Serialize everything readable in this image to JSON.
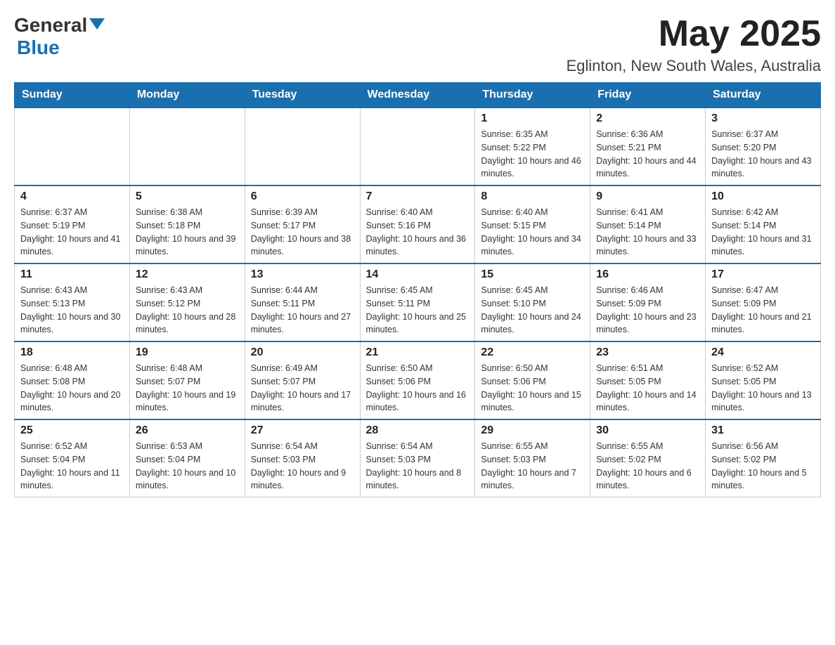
{
  "header": {
    "logo_general": "General",
    "logo_blue": "Blue",
    "month_year": "May 2025",
    "location": "Eglinton, New South Wales, Australia"
  },
  "weekdays": [
    "Sunday",
    "Monday",
    "Tuesday",
    "Wednesday",
    "Thursday",
    "Friday",
    "Saturday"
  ],
  "weeks": [
    [
      {
        "day": "",
        "info": ""
      },
      {
        "day": "",
        "info": ""
      },
      {
        "day": "",
        "info": ""
      },
      {
        "day": "",
        "info": ""
      },
      {
        "day": "1",
        "info": "Sunrise: 6:35 AM\nSunset: 5:22 PM\nDaylight: 10 hours and 46 minutes."
      },
      {
        "day": "2",
        "info": "Sunrise: 6:36 AM\nSunset: 5:21 PM\nDaylight: 10 hours and 44 minutes."
      },
      {
        "day": "3",
        "info": "Sunrise: 6:37 AM\nSunset: 5:20 PM\nDaylight: 10 hours and 43 minutes."
      }
    ],
    [
      {
        "day": "4",
        "info": "Sunrise: 6:37 AM\nSunset: 5:19 PM\nDaylight: 10 hours and 41 minutes."
      },
      {
        "day": "5",
        "info": "Sunrise: 6:38 AM\nSunset: 5:18 PM\nDaylight: 10 hours and 39 minutes."
      },
      {
        "day": "6",
        "info": "Sunrise: 6:39 AM\nSunset: 5:17 PM\nDaylight: 10 hours and 38 minutes."
      },
      {
        "day": "7",
        "info": "Sunrise: 6:40 AM\nSunset: 5:16 PM\nDaylight: 10 hours and 36 minutes."
      },
      {
        "day": "8",
        "info": "Sunrise: 6:40 AM\nSunset: 5:15 PM\nDaylight: 10 hours and 34 minutes."
      },
      {
        "day": "9",
        "info": "Sunrise: 6:41 AM\nSunset: 5:14 PM\nDaylight: 10 hours and 33 minutes."
      },
      {
        "day": "10",
        "info": "Sunrise: 6:42 AM\nSunset: 5:14 PM\nDaylight: 10 hours and 31 minutes."
      }
    ],
    [
      {
        "day": "11",
        "info": "Sunrise: 6:43 AM\nSunset: 5:13 PM\nDaylight: 10 hours and 30 minutes."
      },
      {
        "day": "12",
        "info": "Sunrise: 6:43 AM\nSunset: 5:12 PM\nDaylight: 10 hours and 28 minutes."
      },
      {
        "day": "13",
        "info": "Sunrise: 6:44 AM\nSunset: 5:11 PM\nDaylight: 10 hours and 27 minutes."
      },
      {
        "day": "14",
        "info": "Sunrise: 6:45 AM\nSunset: 5:11 PM\nDaylight: 10 hours and 25 minutes."
      },
      {
        "day": "15",
        "info": "Sunrise: 6:45 AM\nSunset: 5:10 PM\nDaylight: 10 hours and 24 minutes."
      },
      {
        "day": "16",
        "info": "Sunrise: 6:46 AM\nSunset: 5:09 PM\nDaylight: 10 hours and 23 minutes."
      },
      {
        "day": "17",
        "info": "Sunrise: 6:47 AM\nSunset: 5:09 PM\nDaylight: 10 hours and 21 minutes."
      }
    ],
    [
      {
        "day": "18",
        "info": "Sunrise: 6:48 AM\nSunset: 5:08 PM\nDaylight: 10 hours and 20 minutes."
      },
      {
        "day": "19",
        "info": "Sunrise: 6:48 AM\nSunset: 5:07 PM\nDaylight: 10 hours and 19 minutes."
      },
      {
        "day": "20",
        "info": "Sunrise: 6:49 AM\nSunset: 5:07 PM\nDaylight: 10 hours and 17 minutes."
      },
      {
        "day": "21",
        "info": "Sunrise: 6:50 AM\nSunset: 5:06 PM\nDaylight: 10 hours and 16 minutes."
      },
      {
        "day": "22",
        "info": "Sunrise: 6:50 AM\nSunset: 5:06 PM\nDaylight: 10 hours and 15 minutes."
      },
      {
        "day": "23",
        "info": "Sunrise: 6:51 AM\nSunset: 5:05 PM\nDaylight: 10 hours and 14 minutes."
      },
      {
        "day": "24",
        "info": "Sunrise: 6:52 AM\nSunset: 5:05 PM\nDaylight: 10 hours and 13 minutes."
      }
    ],
    [
      {
        "day": "25",
        "info": "Sunrise: 6:52 AM\nSunset: 5:04 PM\nDaylight: 10 hours and 11 minutes."
      },
      {
        "day": "26",
        "info": "Sunrise: 6:53 AM\nSunset: 5:04 PM\nDaylight: 10 hours and 10 minutes."
      },
      {
        "day": "27",
        "info": "Sunrise: 6:54 AM\nSunset: 5:03 PM\nDaylight: 10 hours and 9 minutes."
      },
      {
        "day": "28",
        "info": "Sunrise: 6:54 AM\nSunset: 5:03 PM\nDaylight: 10 hours and 8 minutes."
      },
      {
        "day": "29",
        "info": "Sunrise: 6:55 AM\nSunset: 5:03 PM\nDaylight: 10 hours and 7 minutes."
      },
      {
        "day": "30",
        "info": "Sunrise: 6:55 AM\nSunset: 5:02 PM\nDaylight: 10 hours and 6 minutes."
      },
      {
        "day": "31",
        "info": "Sunrise: 6:56 AM\nSunset: 5:02 PM\nDaylight: 10 hours and 5 minutes."
      }
    ]
  ]
}
